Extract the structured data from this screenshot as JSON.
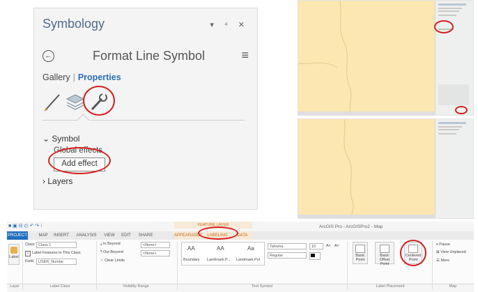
{
  "symbology": {
    "title": "Symbology",
    "window_controls": "▾ ⁴ ✕",
    "back_glyph": "←",
    "subtitle": "Format Line Symbol",
    "menu_glyph": "≡",
    "tabs": {
      "gallery": "Gallery",
      "separator": "|",
      "properties": "Properties"
    },
    "tools": [
      "brush-icon",
      "layers-stack-icon",
      "wrench-icon"
    ],
    "symbol_section": "Symbol",
    "global_effects": "Global effects",
    "add_effect": "Add effect",
    "layers_section": "Layers"
  },
  "ribbon": {
    "app_title": "ArcGIS Pro - ArcGISPro2 - Map",
    "context_group": "FEATURE LAYER",
    "tabs": [
      "PROJECT",
      "MAP",
      "INSERT",
      "ANALYSIS",
      "VIEW",
      "EDIT",
      "SHARE",
      "APPEARANCE",
      "LABELING",
      "DATA"
    ],
    "label_button": "Label",
    "class_label": "Class",
    "class_value": "Class 1",
    "label_features_checkbox": "Label Features in This Class",
    "field_label": "Field",
    "field_value": "USER_Numbe",
    "in_beyond": "In Beyond",
    "out_beyond": "Out Beyond",
    "clear_limits": "Clear Limits",
    "none_1": "<None>",
    "none_2": "<None>",
    "sample_aa": "AA",
    "sample_aa2": "AA",
    "sample_aa3": "Aa",
    "style_boundary": "Boundary",
    "style_landmark1": "Landmark.P...",
    "style_landmark2": "Landmark.Pol",
    "font_name": "Tahoma",
    "font_size": "10",
    "font_style": "Regular",
    "grow_font": "A˄",
    "shrink_font": "A˅",
    "basic_point": "Basic Point",
    "basic_offset_point": "Basic Offset Point",
    "centered_point": "Centered Point",
    "pause": "Pause",
    "view_unplaced": "View Unplaced",
    "more": "More",
    "groups": {
      "layer": "Layer",
      "label_class": "Label Class",
      "visibility_range": "Visibility Range",
      "text_symbol": "Text Symbol",
      "label_placement": "Label Placement",
      "map": "Map"
    }
  },
  "colors": {
    "highlight_ring": "#d32020",
    "map_fill": "#fce6b1",
    "accent": "#2a6ebb"
  }
}
